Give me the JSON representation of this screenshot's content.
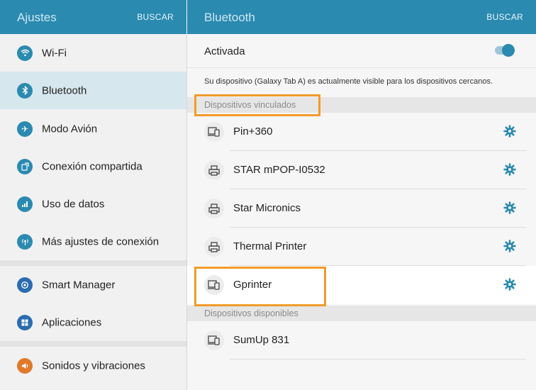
{
  "left_header": {
    "title": "Ajustes",
    "search": "BUSCAR"
  },
  "right_header": {
    "title": "Bluetooth",
    "search": "BUSCAR"
  },
  "sidebar": {
    "items": [
      {
        "label": "Wi-Fi",
        "icon": "wifi-icon",
        "color": "#2b8ab0",
        "glyph": "◉"
      },
      {
        "label": "Bluetooth",
        "icon": "bluetooth-icon",
        "color": "#2b8ab0",
        "glyph": "✱",
        "active": true
      },
      {
        "label": "Modo Avión",
        "icon": "airplane-icon",
        "color": "#2b8ab0",
        "glyph": "✈"
      },
      {
        "label": "Conexión compartida",
        "icon": "tethering-icon",
        "color": "#2b8ab0",
        "glyph": "⧉"
      },
      {
        "label": "Uso de datos",
        "icon": "data-usage-icon",
        "color": "#2b8ab0",
        "glyph": "▥"
      },
      {
        "label": "Más ajustes de conexión",
        "icon": "more-connection-icon",
        "color": "#2b8ab0",
        "glyph": "◎"
      },
      {
        "label": "Smart Manager",
        "icon": "smart-manager-icon",
        "color": "#2b6cb0",
        "glyph": "◎"
      },
      {
        "label": "Aplicaciones",
        "icon": "apps-icon",
        "color": "#2b6cb0",
        "glyph": "▦"
      },
      {
        "label": "Sonidos y vibraciones",
        "icon": "sound-icon",
        "color": "#e07a2b",
        "glyph": "◀"
      }
    ]
  },
  "bluetooth": {
    "status_label": "Activada",
    "toggle_on": true,
    "visible_note": "Su dispositivo (Galaxy Tab A) es actualmente visible para los dispositivos cercanos.",
    "paired_header": "Dispositivos vinculados",
    "paired": [
      {
        "name": "Pin+360",
        "icon": "device-icon"
      },
      {
        "name": "STAR mPOP-I0532",
        "icon": "printer-icon"
      },
      {
        "name": "Star Micronics",
        "icon": "printer-icon"
      },
      {
        "name": "Thermal Printer",
        "icon": "printer-icon"
      },
      {
        "name": "Gprinter",
        "icon": "device-icon"
      }
    ],
    "available_header": "Dispositivos disponibles",
    "available": [
      {
        "name": "SumUp 831",
        "icon": "device-icon"
      }
    ]
  },
  "colors": {
    "accent": "#2b8ab0",
    "highlight": "#f39a2b"
  }
}
